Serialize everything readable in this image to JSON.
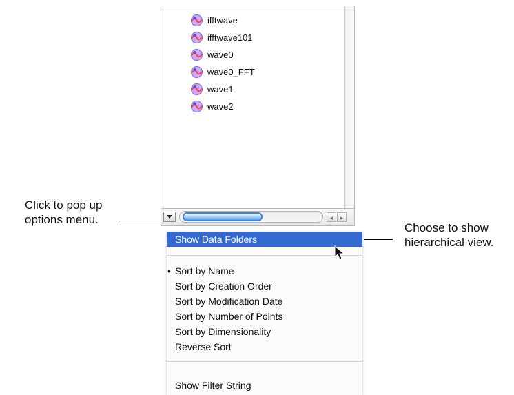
{
  "list": {
    "items": [
      {
        "label": "ifftwave",
        "icon": "wave-icon"
      },
      {
        "label": "ifftwave101",
        "icon": "wave-icon"
      },
      {
        "label": "wave0",
        "icon": "wave-icon"
      },
      {
        "label": "wave0_FFT",
        "icon": "wave-icon"
      },
      {
        "label": "wave1",
        "icon": "wave-icon"
      },
      {
        "label": "wave2",
        "icon": "wave-icon"
      }
    ]
  },
  "callouts": {
    "left_text": "Click to pop up\noptions menu.",
    "right_text": "Choose to show\nhierarchical view."
  },
  "menu": {
    "items": [
      {
        "label": "Show Data Folders",
        "selected": true
      },
      {
        "label": "Sort by Name",
        "checked": true
      },
      {
        "label": "Sort by Creation Order"
      },
      {
        "label": "Sort by Modification Date"
      },
      {
        "label": "Sort by Number of Points"
      },
      {
        "label": "Sort by Dimensionality"
      },
      {
        "label": "Reverse Sort"
      },
      {
        "label": "Show Filter String"
      }
    ]
  },
  "colors": {
    "selection": "#346ad0",
    "scroll_thumb": "#5e9de8"
  },
  "icons": {
    "list_item": "wave-icon",
    "menu_button": "chevron-down-icon",
    "cursor": "cursor-arrow-icon"
  }
}
